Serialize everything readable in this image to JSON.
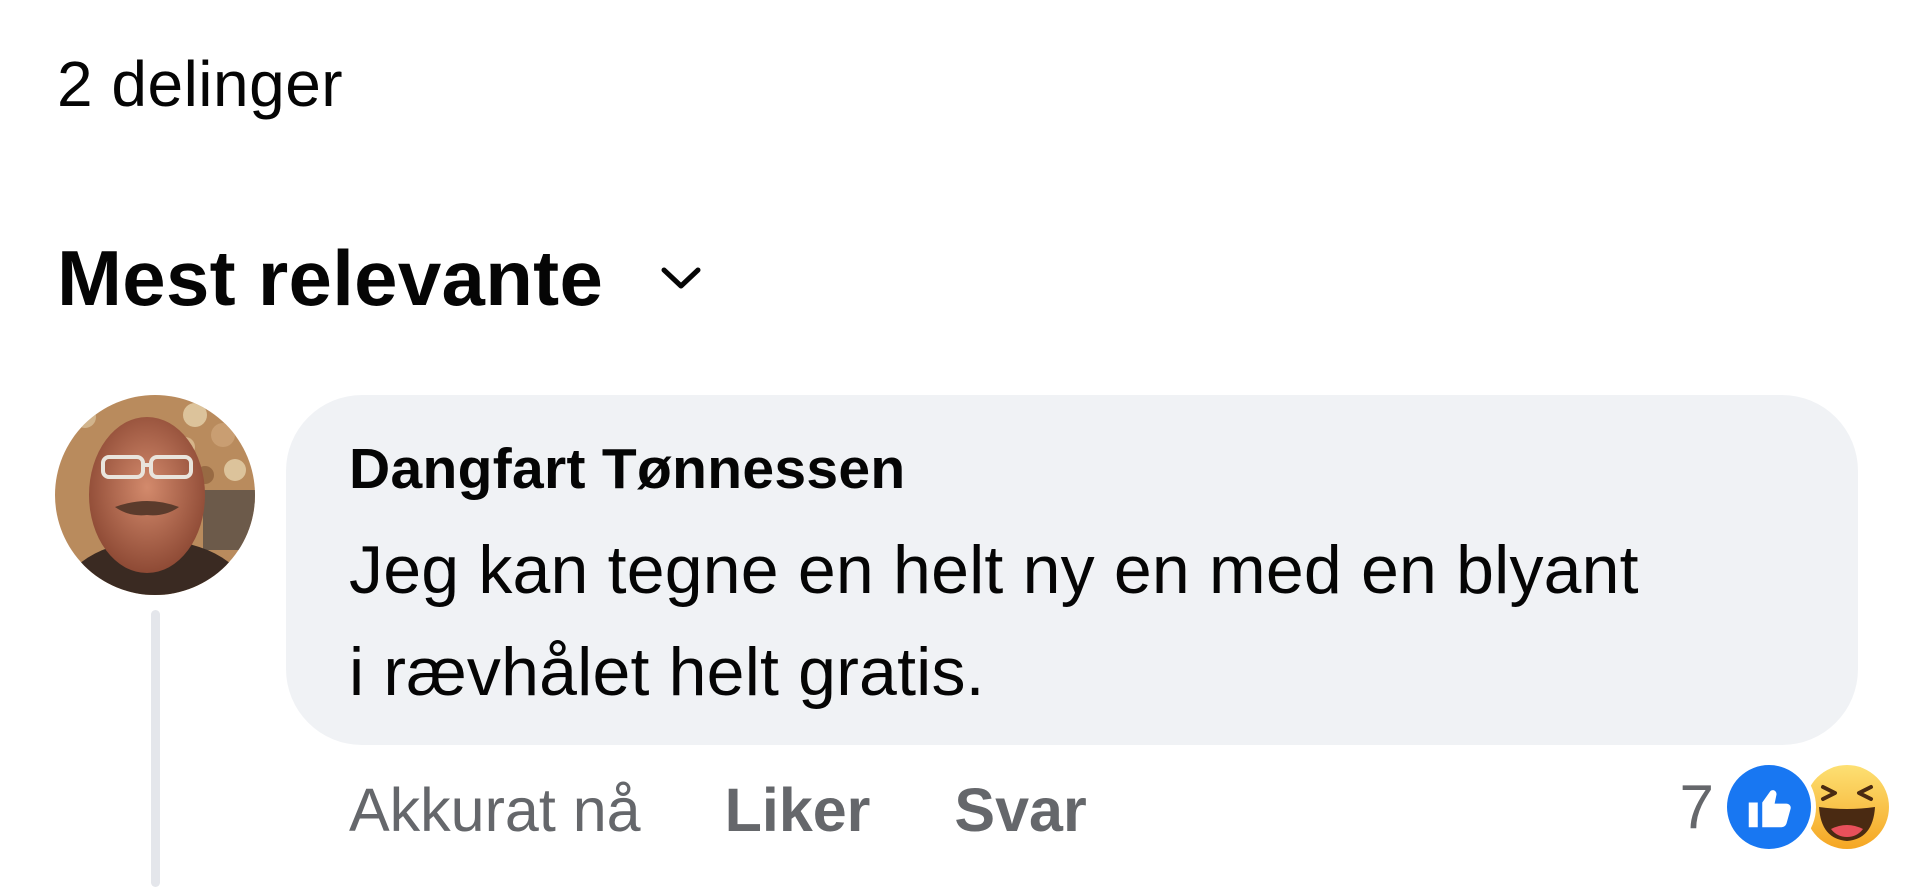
{
  "post": {
    "shares_label": "2 delinger"
  },
  "comments_section": {
    "sort_label": "Mest relevante",
    "sort_icon": "chevron-down-icon"
  },
  "comment": {
    "author": "Dangfart Tønnessen",
    "text_line1": "Jeg kan tegne en helt ny en med en blyant",
    "text_line2": "i rævhålet helt gratis.",
    "timestamp": "Akkurat nå",
    "like_label": "Liker",
    "reply_label": "Svar",
    "reaction_count": "7",
    "reaction_icons": [
      "like-icon",
      "haha-icon"
    ]
  },
  "colors": {
    "bubble_bg": "#f0f2f5",
    "secondary_text": "#65676b",
    "like_blue": "#1877f2",
    "haha_yellow": "#f7c93b"
  }
}
